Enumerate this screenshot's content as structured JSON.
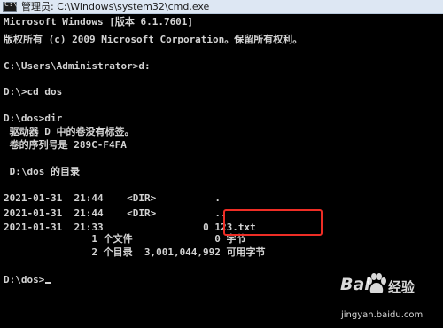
{
  "window": {
    "title": "管理员: C:\\Windows\\system32\\cmd.exe",
    "icon": "cmd-icon",
    "icon_glyph": "C:\\"
  },
  "console": {
    "lines": [
      "Microsoft Windows [版本 6.1.7601]",
      "版权所有 (c) 2009 Microsoft Corporation。保留所有权利。",
      "C:\\Users\\Administrator>d:",
      "D:\\>cd dos",
      "D:\\dos>dir",
      " 驱动器 D 中的卷没有标签。",
      " 卷的序列号是 289C-F4FA",
      " D:\\dos 的目录",
      "2021-01-31  21:44    <DIR>          .",
      "2021-01-31  21:44    <DIR>          ..",
      "2021-01-31  21:33                 0 123.txt",
      "               1 个文件              0 字节",
      "               2 个目录  3,001,044,992 可用字节",
      "D:\\dos>"
    ]
  },
  "annotation": {
    "color": "#ee2d25"
  },
  "watermark": {
    "brand_left": "Bai",
    "brand_right": "经验",
    "url": "jingyan.baidu.com",
    "icon": "paw-icon"
  }
}
